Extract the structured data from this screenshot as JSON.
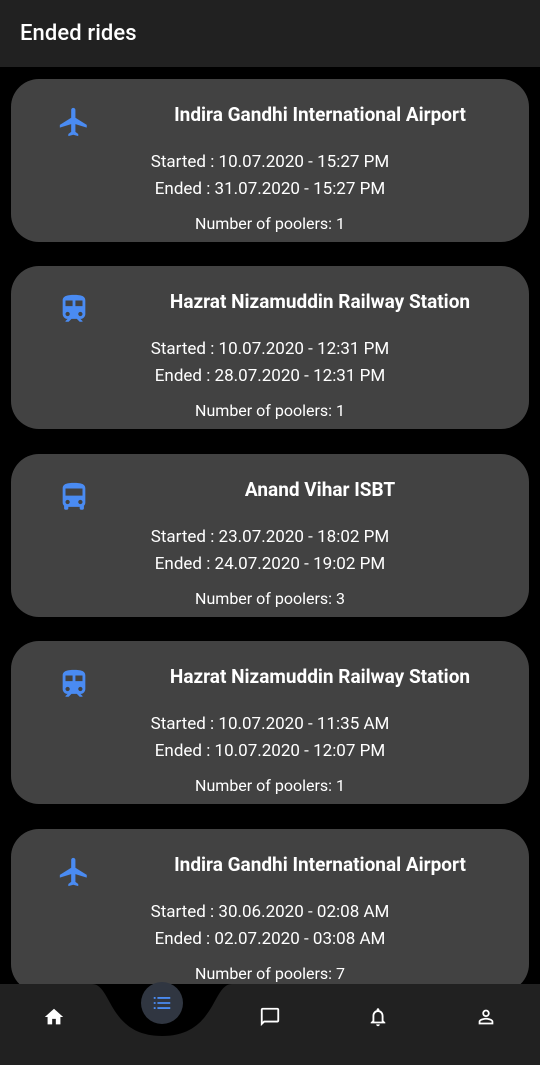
{
  "appbar": {
    "title": "Ended rides"
  },
  "rides": [
    {
      "icon": "airplane-icon",
      "destination": "Indira Gandhi International Airport",
      "started": "Started : 10.07.2020 - 15:27 PM",
      "ended": "Ended : 31.07.2020 - 15:27 PM",
      "poolers": "Number of poolers: 1"
    },
    {
      "icon": "train-icon",
      "destination": "Hazrat Nizamuddin Railway Station",
      "started": "Started : 10.07.2020 - 12:31 PM",
      "ended": "Ended : 28.07.2020 - 12:31 PM",
      "poolers": "Number of poolers: 1"
    },
    {
      "icon": "bus-icon",
      "destination": "Anand Vihar ISBT",
      "started": "Started : 23.07.2020 - 18:02 PM",
      "ended": "Ended : 24.07.2020 - 19:02 PM",
      "poolers": "Number of poolers: 3"
    },
    {
      "icon": "train-icon",
      "destination": "Hazrat Nizamuddin Railway Station",
      "started": "Started : 10.07.2020 - 11:35 AM",
      "ended": "Ended : 10.07.2020 - 12:07 PM",
      "poolers": "Number of poolers: 1"
    },
    {
      "icon": "airplane-icon",
      "destination": "Indira Gandhi International Airport",
      "started": "Started : 30.06.2020 - 02:08 AM",
      "ended": "Ended : 02.07.2020 - 03:08 AM",
      "poolers": "Number of poolers: 7"
    }
  ],
  "bottom_nav": {
    "items": [
      "home-icon",
      "list-icon",
      "chat-icon",
      "bell-icon",
      "person-icon"
    ],
    "active": "list-icon"
  },
  "colors": {
    "accent": "#4a8bf2",
    "card": "#424242",
    "appbar": "#212121",
    "background": "#000000"
  }
}
